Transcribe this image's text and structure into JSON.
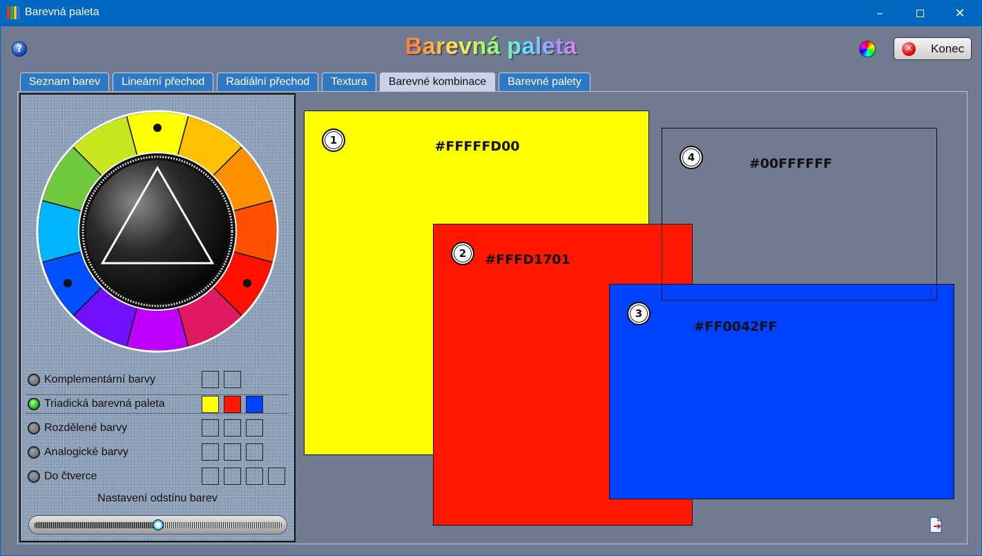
{
  "window": {
    "title": "Barevná paleta",
    "controls": [
      "minimize",
      "maximize",
      "close"
    ]
  },
  "header": {
    "app_title": "Barevná paleta",
    "quit_label": "Konec"
  },
  "tabs": [
    {
      "label": "Seznam barev",
      "active": false
    },
    {
      "label": "Lineární přechod",
      "active": false
    },
    {
      "label": "Radiální přechod",
      "active": false
    },
    {
      "label": "Textura",
      "active": false
    },
    {
      "label": "Barevné kombinace",
      "active": true
    },
    {
      "label": "Barevné palety",
      "active": false
    }
  ],
  "wheel": {
    "segment_colors": [
      "#ffff00",
      "#ffc000",
      "#ff9000",
      "#ff5000",
      "#ff1000",
      "#e01a60",
      "#c000ff",
      "#7010ff",
      "#0050ff",
      "#00b4ff",
      "#70c83c",
      "#c8e61e"
    ],
    "marked_segments": [
      0,
      4,
      8
    ]
  },
  "schemes": [
    {
      "label": "Komplementární barvy",
      "selected": false,
      "swatches": [
        "",
        ""
      ]
    },
    {
      "label": "Triadická barevná paleta",
      "selected": true,
      "swatches": [
        "#ffff00",
        "#ff1701",
        "#0042ff"
      ]
    },
    {
      "label": "Rozdělené barvy",
      "selected": false,
      "swatches": [
        "",
        "",
        ""
      ]
    },
    {
      "label": "Analogické barvy",
      "selected": false,
      "swatches": [
        "",
        "",
        ""
      ]
    },
    {
      "label": "Do čtverce",
      "selected": false,
      "swatches": [
        "",
        "",
        "",
        ""
      ]
    }
  ],
  "shade": {
    "label": "Nastavení odstínu barev",
    "value": 0.5
  },
  "boxes": [
    {
      "number": "1",
      "code": "#FFFFFD00",
      "color": "#ffff00"
    },
    {
      "number": "2",
      "code": "#FFFD1701",
      "color": "#ff1701"
    },
    {
      "number": "3",
      "code": "#FF0042FF",
      "color": "#0042ff"
    },
    {
      "number": "4",
      "code": "#00FFFFFF",
      "color": "transparent"
    }
  ]
}
